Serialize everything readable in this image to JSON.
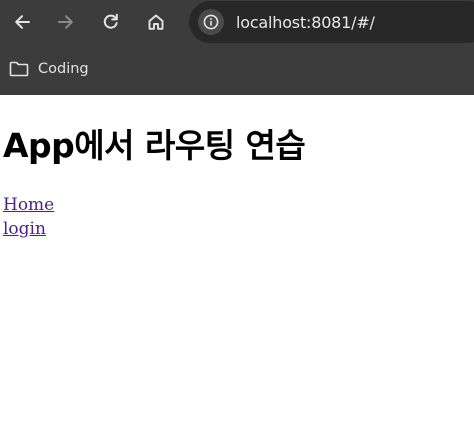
{
  "browser": {
    "url": "localhost:8081/#/",
    "bookmarks": [
      {
        "label": "Coding",
        "icon": "folder-icon"
      }
    ],
    "colors": {
      "chrome_background": "#3c3c3c",
      "omnibox_background": "#282828",
      "icon_color": "#e3e3e3",
      "disabled_icon_color": "#8a8a8a"
    }
  },
  "page": {
    "title": "App에서 라우팅 연습",
    "links": [
      {
        "label": "Home"
      },
      {
        "label": "login"
      }
    ],
    "colors": {
      "link_visited": "#551a8b"
    }
  }
}
